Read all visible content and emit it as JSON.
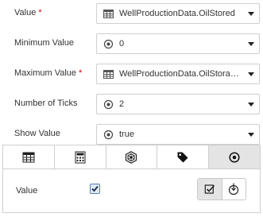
{
  "properties": [
    {
      "label": "Value",
      "required": "*",
      "icon": "table-icon",
      "value": "WellProductionData.OilStored"
    },
    {
      "label": "Minimum Value",
      "required": "",
      "icon": "radio-target-icon",
      "value": "0"
    },
    {
      "label": "Maximum Value",
      "required": "*",
      "icon": "table-icon",
      "value": "WellProductionData.OilStorage..."
    },
    {
      "label": "Number of Ticks",
      "required": "",
      "icon": "radio-target-icon",
      "value": "2"
    },
    {
      "label": "Show Value",
      "required": "",
      "icon": "radio-target-icon",
      "value": "true"
    }
  ],
  "panel": {
    "tabs": [
      "table-icon",
      "calculator-icon",
      "network-icon",
      "tag-icon",
      "radio-target-icon"
    ],
    "active_tab": 4,
    "value_label": "Value",
    "value_checked": true,
    "toggle": [
      "checkbox-icon",
      "pointer-icon"
    ]
  }
}
